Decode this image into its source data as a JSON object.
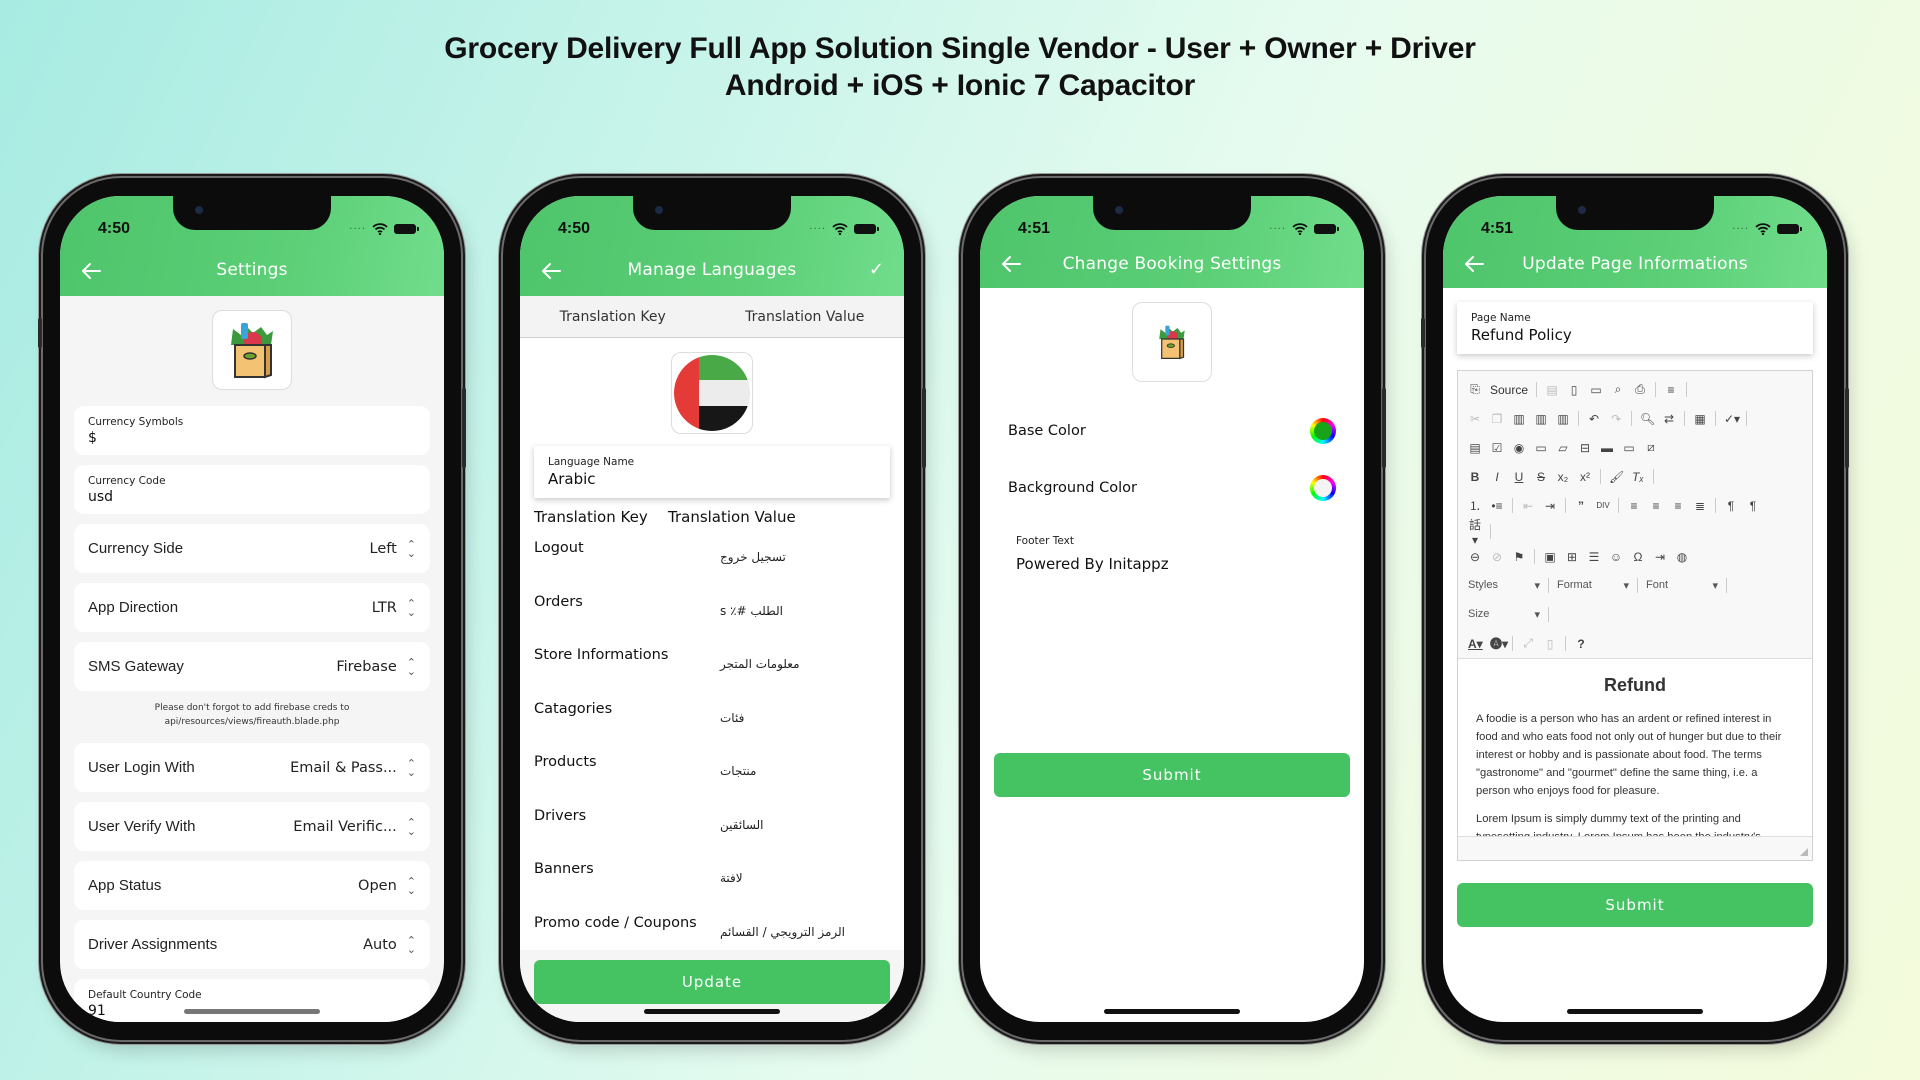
{
  "headline": {
    "line1": "Grocery Delivery Full App Solution Single Vendor - User + Owner + Driver",
    "line2": "Android + iOS + Ionic 7 Capacitor"
  },
  "colors": {
    "primary": "#45c363",
    "appbar_start": "#4ec46b",
    "appbar_end": "#71dd8c",
    "base_color_value": "#18a418",
    "background_color_value": "#f4f4f4"
  },
  "phones": {
    "settings": {
      "time": "4:50",
      "title": "Settings",
      "logo_icon": "grocery-bag-icon",
      "currency_symbols": {
        "label": "Currency Symbols",
        "value": "$"
      },
      "currency_code": {
        "label": "Currency Code",
        "value": "usd"
      },
      "selects": [
        {
          "label": "Currency Side",
          "value": "Left"
        },
        {
          "label": "App Direction",
          "value": "LTR"
        },
        {
          "label": "SMS Gateway",
          "value": "Firebase"
        }
      ],
      "note": "Please don't forgot to add firebase creds to api/resources/views/fireauth.blade.php",
      "selects2": [
        {
          "label": "User Login With",
          "value": "Email & Pass..."
        },
        {
          "label": "User Verify With",
          "value": "Email Verific..."
        },
        {
          "label": "App Status",
          "value": "Open"
        },
        {
          "label": "Driver Assignments",
          "value": "Auto"
        }
      ],
      "default_country_code": {
        "label": "Default Country Code",
        "value": "91"
      }
    },
    "languages": {
      "time": "4:50",
      "title": "Manage Languages",
      "tabs": [
        "Translation Key",
        "Translation Value"
      ],
      "flag_icon": "uae-flag-icon",
      "language_name": {
        "label": "Language Name",
        "value": "Arabic"
      },
      "columns": [
        "Translation Key",
        "Translation Value"
      ],
      "rows": [
        {
          "key": "Logout",
          "value": "تسجيل خروج"
        },
        {
          "key": "Orders",
          "value": "الطلب #٪ s"
        },
        {
          "key": "Store Informations",
          "value": "معلومات المتجر"
        },
        {
          "key": "Catagories",
          "value": "فئات"
        },
        {
          "key": "Products",
          "value": "منتجات"
        },
        {
          "key": "Drivers",
          "value": "السائقين"
        },
        {
          "key": "Banners",
          "value": "لافتة"
        },
        {
          "key": "Promo code / Coupons",
          "value": "الرمز الترويجي / القسائم"
        }
      ],
      "update_label": "Update"
    },
    "booking": {
      "time": "4:51",
      "title": "Change Booking Settings",
      "base_color_label": "Base Color",
      "background_color_label": "Background Color",
      "footer_text": {
        "label": "Footer Text",
        "value": "Powered By Initappz"
      },
      "submit_label": "Submit"
    },
    "page_info": {
      "time": "4:51",
      "title": "Update Page Informations",
      "page_name": {
        "label": "Page Name",
        "value": "Refund Policy"
      },
      "toolbar": {
        "source_label": "Source",
        "styles_label": "Styles",
        "format_label": "Format",
        "font_label": "Font",
        "size_label": "Size"
      },
      "editor": {
        "heading": "Refund",
        "paragraph1": "A foodie is a person who has an ardent or refined interest in food and who eats food not only out of hunger but due to their interest or hobby and is passionate about food. The terms \"gastronome\" and \"gourmet\" define the same thing, i.e. a person who enjoys food for pleasure.",
        "paragraph2": "Lorem Ipsum is simply dummy text of the printing and typesetting industry. Lorem Ipsum has been the industry's"
      },
      "submit_label": "Submit"
    }
  }
}
